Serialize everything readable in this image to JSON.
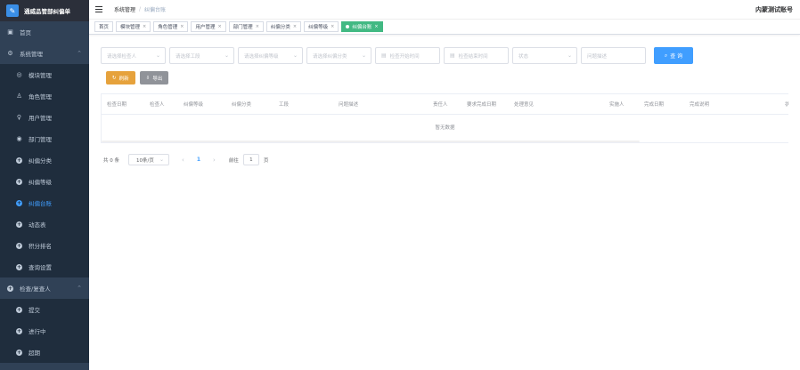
{
  "app": {
    "logo_text": "通威品管部纠偏单",
    "logo_mark": "✎"
  },
  "account": "内蒙测试账号",
  "breadcrumb": [
    "系统管理",
    "纠偏台账"
  ],
  "sidebar": {
    "items": [
      {
        "label": "首页",
        "icon": "dashboard-icon",
        "glyph": "▣"
      },
      {
        "label": "系统管理",
        "icon": "gear-icon",
        "glyph": "⚙",
        "arrow": "⌃"
      },
      {
        "label": "模块管理",
        "icon": "module-icon",
        "glyph": "◎"
      },
      {
        "label": "角色管理",
        "icon": "user-icon",
        "glyph": "♙"
      },
      {
        "label": "用户管理",
        "icon": "bulb-icon",
        "glyph": "♀"
      },
      {
        "label": "部门管理",
        "icon": "dept-icon",
        "glyph": "◉"
      },
      {
        "label": "纠偏分类",
        "icon": "plus-circle-icon",
        "glyph": "+"
      },
      {
        "label": "纠偏等级",
        "icon": "plus-circle-icon",
        "glyph": "+"
      },
      {
        "label": "纠偏台账",
        "icon": "plus-circle-icon",
        "glyph": "+"
      },
      {
        "label": "动态表",
        "icon": "plus-circle-icon",
        "glyph": "+"
      },
      {
        "label": "积分排名",
        "icon": "plus-circle-icon",
        "glyph": "+"
      },
      {
        "label": "查询设置",
        "icon": "plus-circle-icon",
        "glyph": "+"
      },
      {
        "label": "检查/复查人",
        "icon": "plus-circle-icon",
        "glyph": "+",
        "arrow": "⌃"
      },
      {
        "label": "提交",
        "icon": "plus-circle-icon",
        "glyph": "+"
      },
      {
        "label": "进行中",
        "icon": "plus-circle-icon",
        "glyph": "+"
      },
      {
        "label": "超期",
        "icon": "plus-circle-icon",
        "glyph": "+"
      }
    ]
  },
  "tags": [
    "首页",
    "模块管理",
    "角色管理",
    "用户管理",
    "部门管理",
    "纠偏分类",
    "纠偏等级",
    "纠偏台账"
  ],
  "tag_close": "×",
  "filters": {
    "inspector": "请选择检查人",
    "section": "请选择工段",
    "level": "请选择纠偏等级",
    "category": "请选择纠偏分类",
    "start_time": "检查开始时间",
    "end_time": "检查结束时间",
    "status": "状态",
    "description": "问题描述",
    "query_label": "查 询",
    "query_icon": "⌕"
  },
  "actions": {
    "refresh": "刷新",
    "refresh_icon": "↻",
    "export": "导出",
    "export_icon": "⇩"
  },
  "table": {
    "columns": [
      "检查日期",
      "检查人",
      "纠偏等级",
      "纠偏分类",
      "工段",
      "问题描述",
      "责任人",
      "要求完成日期",
      "处理意见",
      "实施人",
      "完成日期",
      "完成说明",
      "状"
    ],
    "empty_text": "暂无数据"
  },
  "pagination": {
    "total": "共 0 条",
    "page_size": "10条/页",
    "prev": "‹",
    "current": "1",
    "next": "›",
    "goto_prefix": "前往",
    "goto_value": "1",
    "goto_suffix": "页"
  },
  "colors": {
    "sidebar_bg": "#304156",
    "submenu_bg": "#1f2d3d",
    "active": "#409eff",
    "tag_active": "#42b983",
    "refresh": "#e6a23c",
    "export": "#909399"
  }
}
